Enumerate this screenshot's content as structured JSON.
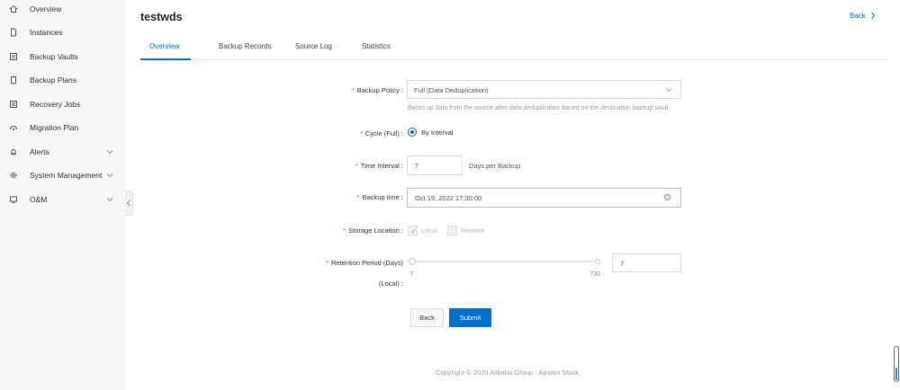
{
  "sidebar": {
    "items": [
      {
        "label": "Overview",
        "icon": "home-icon"
      },
      {
        "label": "Instances",
        "icon": "document-icon"
      },
      {
        "label": "Backup Vaults",
        "icon": "vault-icon"
      },
      {
        "label": "Backup Plans",
        "icon": "clipboard-icon"
      },
      {
        "label": "Recovery Jobs",
        "icon": "list-icon"
      },
      {
        "label": "Migration Plan",
        "icon": "migration-icon"
      },
      {
        "label": "Alerts",
        "icon": "bell-icon"
      },
      {
        "label": "System Management",
        "icon": "gear-icon"
      },
      {
        "label": "O&M",
        "icon": "monitor-icon"
      }
    ]
  },
  "header": {
    "title": "testwds",
    "back_label": "Back"
  },
  "tabs": [
    "Overview",
    "Backup Records",
    "Source Log",
    "Statistics"
  ],
  "form": {
    "backup_policy": {
      "label": "Backup Policy :",
      "value": "Full (Data Deduplication)",
      "helper": "Backs up data from the source after data deduplication based on the destination backup vault."
    },
    "cycle": {
      "label": "Cycle (Full) :",
      "option": "By Interval"
    },
    "time_interval": {
      "label": "Time Interval :",
      "value": "7",
      "unit": "Days per Backup"
    },
    "backup_time": {
      "label": "Backup time :",
      "value": "Oct 19, 2022 17:30:00"
    },
    "storage_location": {
      "label": "Storage Location :",
      "local": "Local",
      "remote": "Remote"
    },
    "retention": {
      "label_line1": "Retention Period (Days)",
      "label_line2": "(Local) :",
      "min": "7",
      "max": "730",
      "value": "7"
    },
    "back_button": "Back",
    "submit_button": "Submit"
  },
  "footer": {
    "copyright": "Copyright © 2020 Alibaba Group - Apsara Stack"
  },
  "colors": {
    "accent": "#0070cc",
    "required": "#e84c3d"
  }
}
